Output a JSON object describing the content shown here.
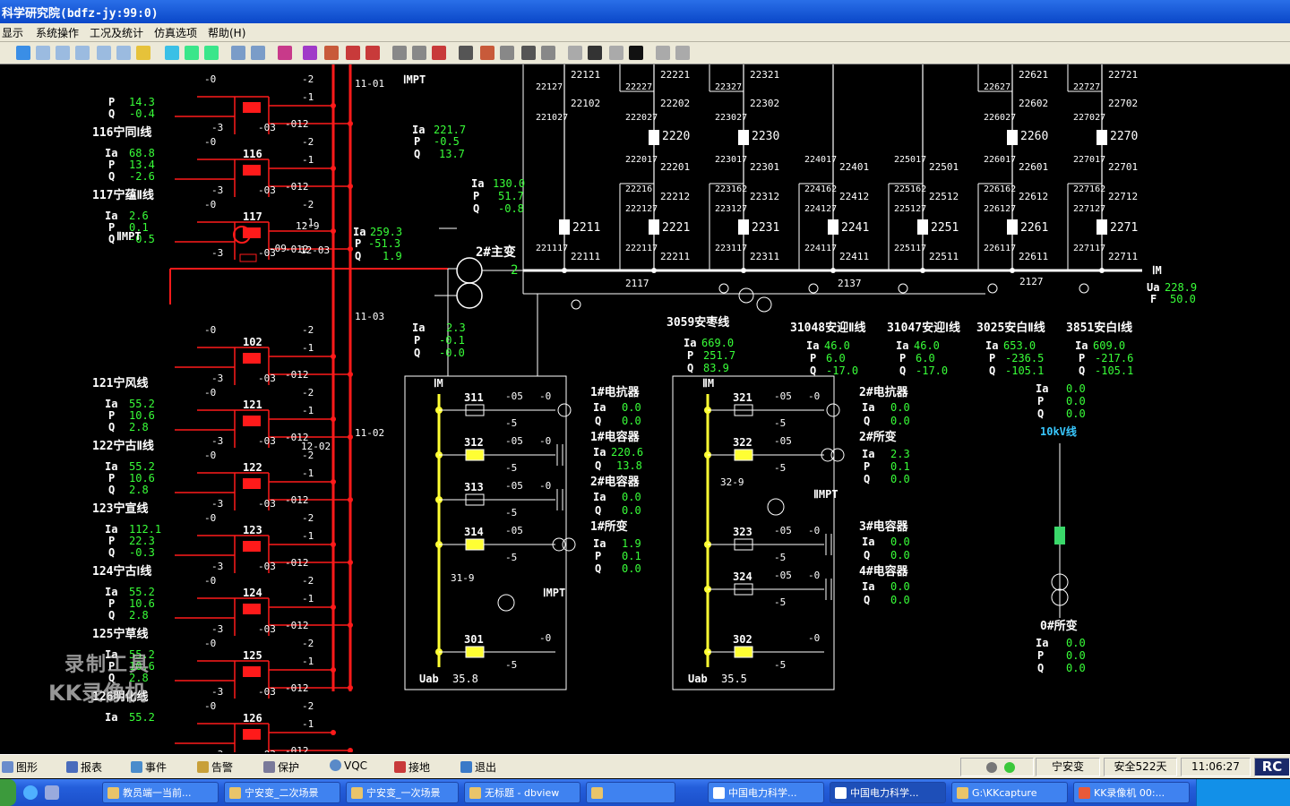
{
  "window": {
    "title": "科学研究院(bdfz-jy:99:0)"
  },
  "menu": [
    "显示",
    "系统操作",
    "工况及统计",
    "仿真选项",
    "帮助(H)"
  ],
  "colors": {
    "bus_left": "#ff1a1a",
    "bus_right": "#ffffff",
    "bus_10kv": "#ffff33",
    "breaker_left": "#ff1a1a",
    "breaker_right": "#ffffff",
    "label": "#ffffff",
    "value": "#39ff39",
    "title_bg": "#0a47c8"
  },
  "left_feeders": [
    {
      "name": "",
      "code": "",
      "ia": "",
      "p": "14.3",
      "q": "-0.4"
    },
    {
      "name": "116宁同Ⅰ线",
      "code": "116",
      "ia": "68.8",
      "p": "13.4",
      "q": "-2.6"
    },
    {
      "name": "117宁蕴Ⅱ线",
      "code": "117",
      "ia": "2.6",
      "p": "0.1",
      "q": "-0.5"
    },
    {
      "name": "",
      "code": "102",
      "ia": "",
      "p": "",
      "q": ""
    },
    {
      "name": "121宁风线",
      "code": "121",
      "ia": "55.2",
      "p": "10.6",
      "q": "2.8"
    },
    {
      "name": "122宁古Ⅱ线",
      "code": "122",
      "ia": "55.2",
      "p": "10.6",
      "q": "2.8"
    },
    {
      "name": "123宁宣线",
      "code": "123",
      "ia": "112.1",
      "p": "22.3",
      "q": "-0.3"
    },
    {
      "name": "124宁古Ⅰ线",
      "code": "124",
      "ia": "55.2",
      "p": "10.6",
      "q": "2.8"
    },
    {
      "name": "125宁草线",
      "code": "125",
      "ia": "55.2",
      "p": "10.6",
      "q": "2.8"
    },
    {
      "name": "126明化线",
      "code": "126",
      "ia": "55.2",
      "p": "",
      "q": ""
    }
  ],
  "left_switch_labels": {
    "s0": "-0",
    "s1": "-1",
    "s2": "-2",
    "s3": "-3",
    "s03": "-03",
    "s012": "-012"
  },
  "left_bus_labels": {
    "b1": "11-01",
    "b3": "11-03",
    "b2": "11-02",
    "pt1": "ⅠMPT",
    "pt2": "ⅡMPT",
    "s129": "12-9",
    "s1203": "12-03",
    "s09": "-09",
    "s1202": "12-02"
  },
  "left_side_meter": {
    "ia_lbl": "Ia",
    "p_lbl": "P",
    "q_lbl": "Q",
    "ia": "259.3",
    "p": "-51.3",
    "q": "1.9"
  },
  "transformer": {
    "name": "2#主变",
    "tap": "2",
    "hv": {
      "ia": "221.7",
      "p": "-0.5",
      "q": "13.7"
    },
    "mv": {
      "ia": "130.0",
      "p": "51.7",
      "q": "-0.8"
    },
    "lv": {
      "ia": "2.3",
      "p": "-0.1",
      "q": "-0.0"
    }
  },
  "top_bays": [
    {
      "codes": [
        "22121",
        "22102",
        "2211",
        "22111"
      ],
      "left": [
        "22127",
        "221027",
        "221117"
      ]
    },
    {
      "codes": [
        "22221",
        "22202",
        "2220",
        "22201",
        "22212",
        "2221",
        "22211"
      ],
      "left": [
        "22227",
        "222027",
        "222017",
        "22216",
        "222127",
        "222117"
      ]
    },
    {
      "codes": [
        "22321",
        "22302",
        "2230",
        "22301",
        "22312",
        "2231",
        "22311"
      ],
      "left": [
        "22327",
        "223027",
        "223017",
        "223162",
        "223127",
        "223117"
      ]
    },
    {
      "codes": [
        "22401",
        "22412",
        "2241",
        "22411"
      ],
      "left": [
        "224017",
        "224162",
        "224127",
        "224117"
      ]
    },
    {
      "codes": [
        "22501",
        "22512",
        "2251",
        "22511"
      ],
      "left": [
        "225017",
        "225162",
        "225127",
        "225117"
      ]
    },
    {
      "codes": [
        "22621",
        "22602",
        "2260",
        "22601",
        "22612",
        "2261",
        "22611"
      ],
      "left": [
        "22627",
        "226027",
        "226017",
        "226162",
        "226127",
        "226117"
      ]
    },
    {
      "codes": [
        "22721",
        "22702",
        "2270",
        "22701",
        "22712",
        "2271",
        "22711"
      ],
      "left": [
        "22727",
        "227027",
        "227017",
        "227162",
        "227127",
        "227117"
      ]
    }
  ],
  "bus_220": {
    "name": "ⅠM",
    "ua_lbl": "Ua",
    "ua": "228.9",
    "f_lbl": "F",
    "f": "50.0"
  },
  "pt_codes": {
    "c2117": "2117",
    "c2137": "2137",
    "c2127": "2127"
  },
  "lines_220": [
    {
      "name": "3059安枣线",
      "ia": "669.0",
      "p": "251.7",
      "q": "83.9"
    },
    {
      "name": "31048安迎Ⅱ线",
      "ia": "46.0",
      "p": "6.0",
      "q": "-17.0"
    },
    {
      "name": "31047安迎Ⅰ线",
      "ia": "46.0",
      "p": "6.0",
      "q": "-17.0"
    },
    {
      "name": "3025安白Ⅱ线",
      "ia": "653.0",
      "p": "-236.5",
      "q": "-105.1"
    },
    {
      "name": "3851安白Ⅰ线",
      "ia": "609.0",
      "p": "-217.6",
      "q": "-105.1"
    }
  ],
  "lv_left": {
    "bus": "ⅠM",
    "b311": "311",
    "b312": "312",
    "b313": "313",
    "b314": "314",
    "b301": "301",
    "s319": "31-9",
    "pt": "ⅠMPT",
    "s05": "-05",
    "s0": "-0",
    "s5": "-5",
    "reactor": {
      "name": "1#电抗器",
      "ia": "0.0",
      "q": "0.0"
    },
    "cap1": {
      "name": "1#电容器",
      "ia": "220.6",
      "q": "13.8"
    },
    "cap2": {
      "name": "2#电容器",
      "ia": "0.0",
      "q": "0.0"
    },
    "st": {
      "name": "1#所变",
      "ia": "1.9",
      "p": "0.1",
      "q": "0.0"
    },
    "uab_lbl": "Uab",
    "uab": "35.8"
  },
  "lv_right": {
    "bus": "ⅡM",
    "b321": "321",
    "b322": "322",
    "b323": "323",
    "b324": "324",
    "b302": "302",
    "s329": "32-9",
    "pt": "ⅡMPT",
    "reactor": {
      "name": "2#电抗器",
      "ia": "0.0",
      "q": "0.0"
    },
    "st": {
      "name": "2#所变",
      "ia": "2.3",
      "p": "0.1",
      "q": "0.0"
    },
    "cap3": {
      "name": "3#电容器",
      "ia": "0.0",
      "q": "0.0"
    },
    "cap4": {
      "name": "4#电容器",
      "ia": "0.0",
      "q": "0.0"
    },
    "uab_lbl": "Uab",
    "uab": "35.5"
  },
  "kv10": {
    "name": "10kV线",
    "top": {
      "ia": "0.0",
      "p": "0.0",
      "q": "0.0"
    },
    "st0": {
      "name": "0#所变",
      "ia": "0.0",
      "p": "0.0",
      "q": "0.0"
    }
  },
  "bottom_tabs": [
    "图形",
    "报表",
    "事件",
    "告警",
    "保护",
    "VQC",
    "接地",
    "退出"
  ],
  "status": {
    "station": "宁安变",
    "safe_days": "安全522天",
    "time": "11:06:27",
    "logo": "RC"
  },
  "taskbar": [
    "教员端一当前...",
    "宁安变_二次场景",
    "宁安变_一次场景",
    "无标题 - dbview",
    "中国电力科学...",
    "中国电力科学...",
    "G:\\KKcapture",
    "KK录像机 00:..."
  ],
  "watermark": [
    "录制工具",
    "KK录像机"
  ]
}
